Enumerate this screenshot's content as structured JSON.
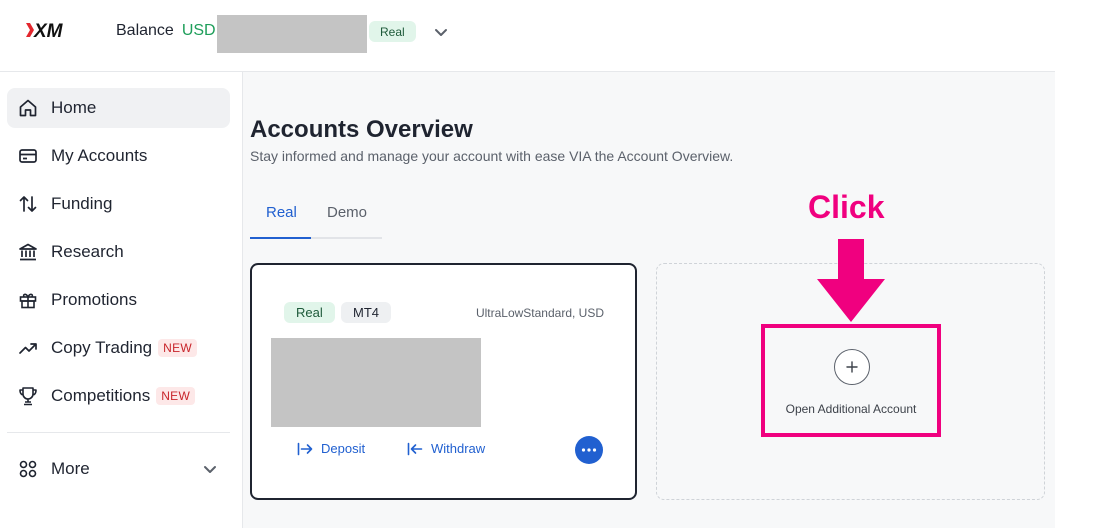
{
  "header": {
    "balance_label": "Balance",
    "balance_currency": "USD",
    "account_badge": "Real"
  },
  "sidebar": {
    "items": [
      {
        "label": "Home",
        "icon": "home-icon"
      },
      {
        "label": "My Accounts",
        "icon": "wallet-icon"
      },
      {
        "label": "Funding",
        "icon": "arrows-up-down-icon"
      },
      {
        "label": "Research",
        "icon": "bank-icon"
      },
      {
        "label": "Promotions",
        "icon": "gift-icon"
      },
      {
        "label": "Copy Trading",
        "icon": "trend-up-icon",
        "badge": "NEW"
      },
      {
        "label": "Competitions",
        "icon": "trophy-icon",
        "badge": "NEW"
      }
    ],
    "more_label": "More"
  },
  "main": {
    "title": "Accounts Overview",
    "subtitle": "Stay informed and manage your account with ease VIA the Account Overview.",
    "tabs": [
      {
        "label": "Real",
        "active": true
      },
      {
        "label": "Demo",
        "active": false
      }
    ],
    "account_card": {
      "type_badge": "Real",
      "platform_badge": "MT4",
      "account_type": "UltraLowStandard, USD",
      "deposit_label": "Deposit",
      "withdraw_label": "Withdraw"
    },
    "add_account": {
      "label": "Open Additional Account"
    },
    "annotation": {
      "text": "Click",
      "color": "#f0007f"
    }
  },
  "colors": {
    "accent": "#2160d0",
    "positive": "#1e9e5a",
    "badge_new": "#c8252b"
  }
}
